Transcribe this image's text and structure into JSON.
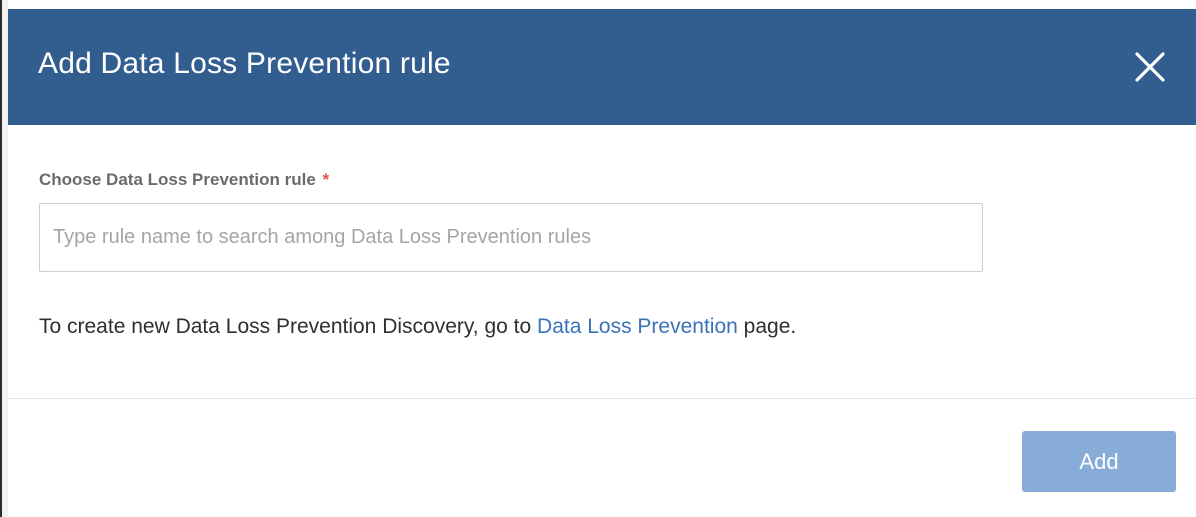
{
  "dialog": {
    "title": "Add Data Loss Prevention rule",
    "close_icon": "close-icon"
  },
  "form": {
    "label": "Choose Data Loss Prevention rule",
    "required_marker": "*",
    "input_value": "",
    "input_placeholder": "Type rule name to search among Data Loss Prevention rules"
  },
  "info": {
    "prefix": "To create new Data Loss Prevention Discovery, go to ",
    "link_text": "Data Loss Prevention",
    "suffix": " page."
  },
  "footer": {
    "add_label": "Add"
  },
  "colors": {
    "header_bg": "#325d8f",
    "link": "#3a73b6",
    "required": "#d9534f",
    "add_button_bg": "#87acd8"
  }
}
